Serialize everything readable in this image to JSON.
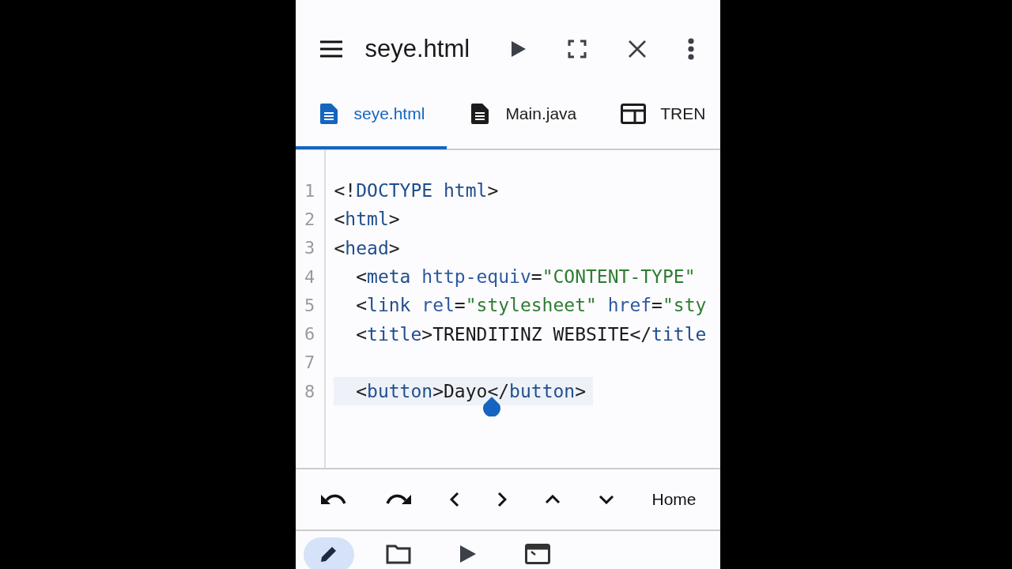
{
  "app_bar": {
    "title": "seye.html"
  },
  "tabs": [
    {
      "label": "seye.html",
      "kind": "file",
      "selected": true
    },
    {
      "label": "Main.java",
      "kind": "file",
      "selected": false
    },
    {
      "label": "TREN",
      "kind": "layout",
      "selected": false
    }
  ],
  "editor": {
    "lines": [
      {
        "number": "1",
        "current": false,
        "tokens": [
          {
            "kind": "punct",
            "text": "<!"
          },
          {
            "kind": "tag",
            "text": "DOCTYPE html"
          },
          {
            "kind": "punct",
            "text": ">"
          }
        ]
      },
      {
        "number": "2",
        "current": false,
        "tokens": [
          {
            "kind": "punct",
            "text": "<"
          },
          {
            "kind": "tag",
            "text": "html"
          },
          {
            "kind": "punct",
            "text": ">"
          }
        ]
      },
      {
        "number": "3",
        "current": false,
        "tokens": [
          {
            "kind": "punct",
            "text": "<"
          },
          {
            "kind": "tag",
            "text": "head"
          },
          {
            "kind": "punct",
            "text": ">"
          }
        ]
      },
      {
        "number": "4",
        "current": false,
        "tokens": [
          {
            "kind": "punct",
            "text": "  <"
          },
          {
            "kind": "tag",
            "text": "meta"
          },
          {
            "kind": "attr",
            "text": " http-equiv"
          },
          {
            "kind": "punct",
            "text": "="
          },
          {
            "kind": "string",
            "text": "\"CONTENT-TYPE\""
          }
        ]
      },
      {
        "number": "5",
        "current": false,
        "tokens": [
          {
            "kind": "punct",
            "text": "  <"
          },
          {
            "kind": "tag",
            "text": "link"
          },
          {
            "kind": "attr",
            "text": " rel"
          },
          {
            "kind": "punct",
            "text": "="
          },
          {
            "kind": "string",
            "text": "\"stylesheet\""
          },
          {
            "kind": "attr",
            "text": " href"
          },
          {
            "kind": "punct",
            "text": "="
          },
          {
            "kind": "string",
            "text": "\"sty"
          }
        ]
      },
      {
        "number": "6",
        "current": false,
        "tokens": [
          {
            "kind": "punct",
            "text": "  <"
          },
          {
            "kind": "tag",
            "text": "title"
          },
          {
            "kind": "punct",
            "text": ">"
          },
          {
            "kind": "text",
            "text": "TRENDITINZ WEBSITE"
          },
          {
            "kind": "punct",
            "text": "</"
          },
          {
            "kind": "tag",
            "text": "title"
          }
        ]
      },
      {
        "number": "7",
        "current": false
      },
      {
        "number": "8",
        "current": true,
        "tokens": [
          {
            "kind": "punct",
            "text": "  <"
          },
          {
            "kind": "tag",
            "text": "button"
          },
          {
            "kind": "punct",
            "text": ">"
          },
          {
            "kind": "text",
            "text": "Dayo"
          },
          {
            "kind": "punct",
            "text": "</"
          },
          {
            "kind": "tag",
            "text": "button"
          },
          {
            "kind": "punct",
            "text": ">"
          }
        ]
      }
    ]
  },
  "key_bar": [
    {
      "kind": "undo"
    },
    {
      "kind": "redo"
    },
    {
      "kind": "left"
    },
    {
      "kind": "right"
    },
    {
      "kind": "up"
    },
    {
      "kind": "down"
    },
    {
      "kind": "text",
      "label": "Home"
    }
  ],
  "bottom_nav": [
    {
      "kind": "edit",
      "selected": true
    },
    {
      "kind": "files",
      "selected": false
    },
    {
      "kind": "run",
      "selected": false
    },
    {
      "kind": "terminal",
      "selected": false
    }
  ]
}
